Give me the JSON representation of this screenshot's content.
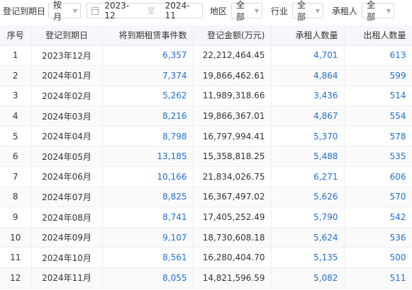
{
  "filters": {
    "date_label": "登记到期日",
    "period_select": "按月",
    "start_date": "2023-12",
    "range_separator": "至",
    "end_date": "2024-11",
    "region_label": "地区",
    "region_select": "全部",
    "industry_label": "行业",
    "industry_select": "全部",
    "lessee_label": "承租人",
    "lessee_select": "全部"
  },
  "table": {
    "headers": [
      "序号",
      "登记到期日",
      "将到期租赁事件数",
      "登记金额(万元)",
      "承租人数量",
      "出租人数量"
    ],
    "rows": [
      [
        "1",
        "2023年12月",
        "6,357",
        "22,212,464.45",
        "4,701",
        "613"
      ],
      [
        "2",
        "2024年01月",
        "7,374",
        "19,866,462.61",
        "4,864",
        "599"
      ],
      [
        "3",
        "2024年02月",
        "5,262",
        "11,989,318.66",
        "3,436",
        "514"
      ],
      [
        "4",
        "2024年03月",
        "8,216",
        "19,866,367.01",
        "4,867",
        "554"
      ],
      [
        "5",
        "2024年04月",
        "8,798",
        "16,797,994.41",
        "5,370",
        "578"
      ],
      [
        "6",
        "2024年05月",
        "13,185",
        "15,358,818.25",
        "5,488",
        "535"
      ],
      [
        "7",
        "2024年06月",
        "10,166",
        "21,834,026.75",
        "6,271",
        "606"
      ],
      [
        "8",
        "2024年07月",
        "8,825",
        "16,367,497.02",
        "5,626",
        "570"
      ],
      [
        "9",
        "2024年08月",
        "8,741",
        "17,405,252.49",
        "5,790",
        "542"
      ],
      [
        "10",
        "2024年09月",
        "9,107",
        "18,730,608.18",
        "5,624",
        "536"
      ],
      [
        "11",
        "2024年10月",
        "8,561",
        "16,280,404.70",
        "5,135",
        "500"
      ],
      [
        "12",
        "2024年11月",
        "8,055",
        "14,821,596.59",
        "5,082",
        "511"
      ]
    ]
  },
  "colors": {
    "link": "#1f6fd1",
    "header_bg": "#f5f7fa",
    "border": "#ebeef5"
  }
}
